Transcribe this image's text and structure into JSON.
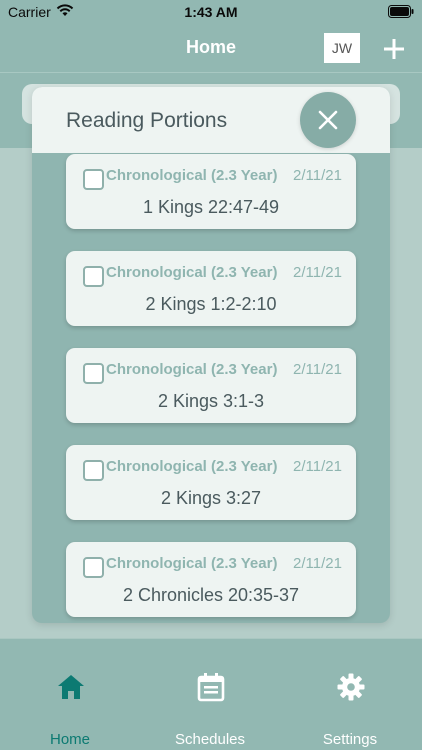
{
  "status_bar": {
    "carrier": "Carrier",
    "time": "1:43 AM"
  },
  "nav": {
    "title": "Home",
    "avatar_initials": "JW"
  },
  "modal": {
    "title": "Reading Portions",
    "items": [
      {
        "schedule": "Chronological (2.3 Year)",
        "date": "2/11/21",
        "portion": "1 Kings 22:47-49",
        "checked": false
      },
      {
        "schedule": "Chronological (2.3 Year)",
        "date": "2/11/21",
        "portion": "2 Kings 1:2-2:10",
        "checked": false
      },
      {
        "schedule": "Chronological (2.3 Year)",
        "date": "2/11/21",
        "portion": "2 Kings 3:1-3",
        "checked": false
      },
      {
        "schedule": "Chronological (2.3 Year)",
        "date": "2/11/21",
        "portion": "2 Kings 3:27",
        "checked": false
      },
      {
        "schedule": "Chronological (2.3 Year)",
        "date": "2/11/21",
        "portion": "2 Chronicles 20:35-37",
        "checked": false
      }
    ]
  },
  "tabs": [
    {
      "label": "Home",
      "icon": "home-icon",
      "active": true
    },
    {
      "label": "Schedules",
      "icon": "calendar-icon",
      "active": false
    },
    {
      "label": "Settings",
      "icon": "gear-icon",
      "active": false
    }
  ],
  "colors": {
    "primary": "#92b8b2",
    "accent_active": "#0c7a72",
    "card": "#eef4f2",
    "text": "#4a5a5e"
  }
}
